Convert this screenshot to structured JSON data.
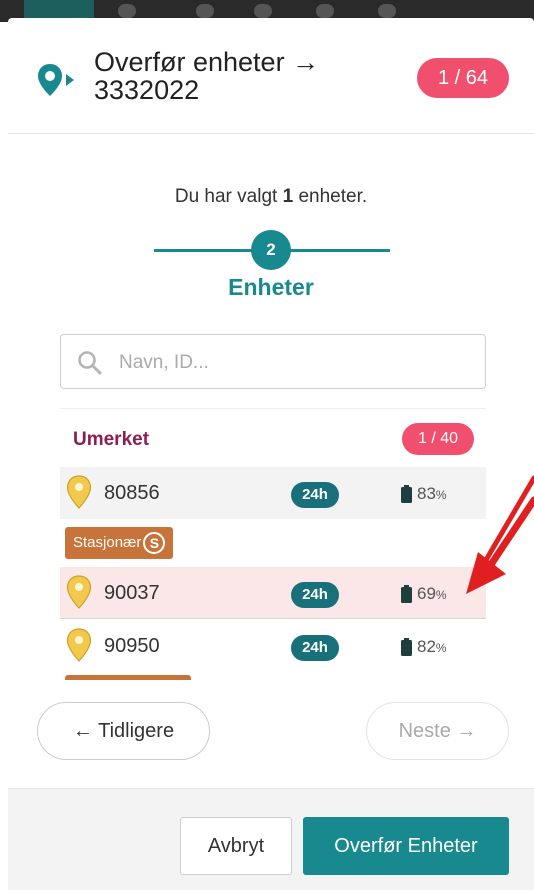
{
  "header": {
    "title": "Overfør enheter → 3332022",
    "counter": "1 / 64"
  },
  "selection": {
    "prefix": "Du har valgt",
    "count": "1",
    "suffix": "enheter."
  },
  "stepper": {
    "step_number": "2",
    "step_label": "Enheter"
  },
  "search": {
    "placeholder": "Navn, ID..."
  },
  "group": {
    "name": "Umerket",
    "count": "1 / 40"
  },
  "units": [
    {
      "id": "80856",
      "badge": "24h",
      "battery": "83",
      "pct_sign": "%",
      "tag": "Stasjonær",
      "tag_icon": "S"
    },
    {
      "id": "90037",
      "badge": "24h",
      "battery": "69",
      "pct_sign": "%",
      "highlighted": true
    },
    {
      "id": "90950",
      "badge": "24h",
      "battery": "82",
      "pct_sign": "%"
    }
  ],
  "navigation": {
    "prev_label": "Tidligere",
    "next_label": "Neste"
  },
  "footer": {
    "cancel_label": "Avbryt",
    "confirm_label": "Overfør Enheter"
  },
  "icons": {
    "header": "location-arrow-icon",
    "search": "search-icon",
    "unit": "map-pin-icon",
    "battery": "battery-icon",
    "prev": "arrow-left-icon",
    "next": "arrow-right-icon"
  },
  "colors": {
    "accent": "#17898f",
    "badge": "#f0506e",
    "group_name": "#8b1f52",
    "tag": "#c8733a",
    "highlight_row": "#fbe6e8",
    "annotation_arrow": "#e02020"
  }
}
